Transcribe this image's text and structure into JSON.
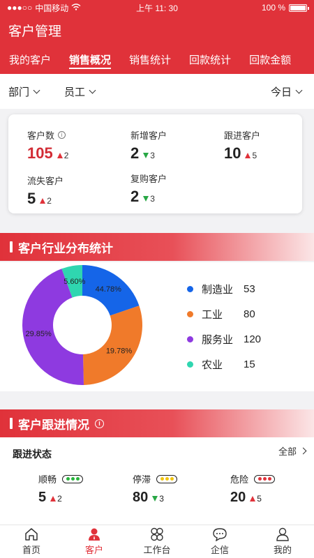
{
  "status_bar": {
    "carrier": "中国移动",
    "time": "上午 11: 30",
    "battery": "100 %"
  },
  "header": {
    "title": "客户管理"
  },
  "tabs": [
    {
      "label": "我的客户",
      "active": false
    },
    {
      "label": "销售概况",
      "active": true
    },
    {
      "label": "销售统计",
      "active": false
    },
    {
      "label": "回款统计",
      "active": false
    },
    {
      "label": "回款金额",
      "active": false
    }
  ],
  "filters": {
    "dept": "部门",
    "staff": "员工",
    "period": "今日"
  },
  "stats": {
    "customers": {
      "label": "客户数",
      "value": "105",
      "delta": "2",
      "direction": "up"
    },
    "new": {
      "label": "新增客户",
      "value": "2",
      "delta": "3",
      "direction": "down"
    },
    "follow": {
      "label": "跟进客户",
      "value": "10",
      "delta": "5",
      "direction": "up"
    },
    "lost": {
      "label": "流失客户",
      "value": "5",
      "delta": "2",
      "direction": "up"
    },
    "repeat": {
      "label": "复购客户",
      "value": "2",
      "delta": "3",
      "direction": "down"
    }
  },
  "industry_section": {
    "title": "客户行业分布统计"
  },
  "chart_data": {
    "type": "pie",
    "donut": true,
    "categories": [
      "制造业",
      "工业",
      "服务业",
      "农业"
    ],
    "values": [
      53,
      80,
      120,
      15
    ],
    "slice_labels": [
      "44.78%",
      "19.78%",
      "29.85%",
      "5.60%"
    ],
    "percents": [
      44.78,
      19.78,
      29.85,
      5.6
    ],
    "colors": [
      "#1565e8",
      "#f07a2a",
      "#8e3ae0",
      "#2fd6b0"
    ]
  },
  "follow_section": {
    "title": "客户跟进情况"
  },
  "follow": {
    "heading": "跟进状态",
    "all_label": "全部",
    "items": [
      {
        "label": "顺畅",
        "value": "5",
        "delta": "2",
        "direction": "up",
        "light": "#28b43c"
      },
      {
        "label": "停滞",
        "value": "80",
        "delta": "3",
        "direction": "down",
        "light": "#f1c40f"
      },
      {
        "label": "危险",
        "value": "20",
        "delta": "5",
        "direction": "up",
        "light": "#e0323a"
      }
    ]
  },
  "tabbar": [
    {
      "label": "首页",
      "icon": "home-icon",
      "active": false
    },
    {
      "label": "客户",
      "icon": "customer-icon",
      "active": true
    },
    {
      "label": "工作台",
      "icon": "grid-icon",
      "active": false
    },
    {
      "label": "企信",
      "icon": "chat-icon",
      "active": false
    },
    {
      "label": "我的",
      "icon": "user-icon",
      "active": false
    }
  ]
}
